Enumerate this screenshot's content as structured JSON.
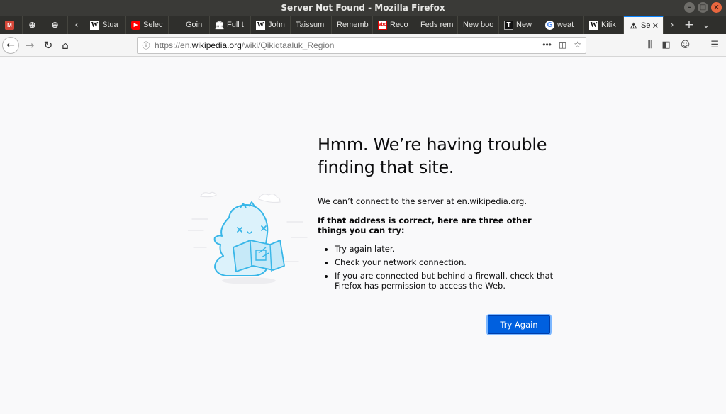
{
  "window": {
    "title": "Server Not Found - Mozilla Firefox"
  },
  "tabs": [
    {
      "label": "",
      "icon": "gmail-icon",
      "pinned": true
    },
    {
      "label": "",
      "icon": "globe-icon",
      "pinned": true
    },
    {
      "label": "",
      "icon": "globe-icon",
      "pinned": true
    },
    {
      "label": "Stua",
      "icon": "wikipedia-icon"
    },
    {
      "label": "Selec",
      "icon": "youtube-icon"
    },
    {
      "label": "Goin",
      "icon": ""
    },
    {
      "label": "Full t",
      "icon": "museum-icon"
    },
    {
      "label": "John",
      "icon": "wikipedia-icon"
    },
    {
      "label": "Taissum",
      "icon": ""
    },
    {
      "label": "Rememb",
      "icon": ""
    },
    {
      "label": "Reco",
      "icon": "abc-icon"
    },
    {
      "label": "Feds rem",
      "icon": ""
    },
    {
      "label": "New boo",
      "icon": ""
    },
    {
      "label": "New",
      "icon": "t-icon"
    },
    {
      "label": "weat",
      "icon": "google-icon"
    },
    {
      "label": "Kitik",
      "icon": "wikipedia-icon"
    },
    {
      "label": "Se",
      "icon": "warning-icon",
      "active": true
    }
  ],
  "url": {
    "prefix": "https://en.",
    "host": "wikipedia.org",
    "path": "/wiki/Qikiqtaaluk_Region"
  },
  "error": {
    "title": "Hmm. We’re having trouble finding that site.",
    "description": "We can’t connect to the server at en.wikipedia.org.",
    "subhead": "If that address is correct, here are three other things you can try:",
    "tips": [
      "Try again later.",
      "Check your network connection.",
      "If you are connected but behind a firewall, check that Firefox has permission to access the Web."
    ],
    "button": "Try Again"
  },
  "colors": {
    "accent": "#0060df",
    "active_tab_line": "#0a84ff"
  }
}
